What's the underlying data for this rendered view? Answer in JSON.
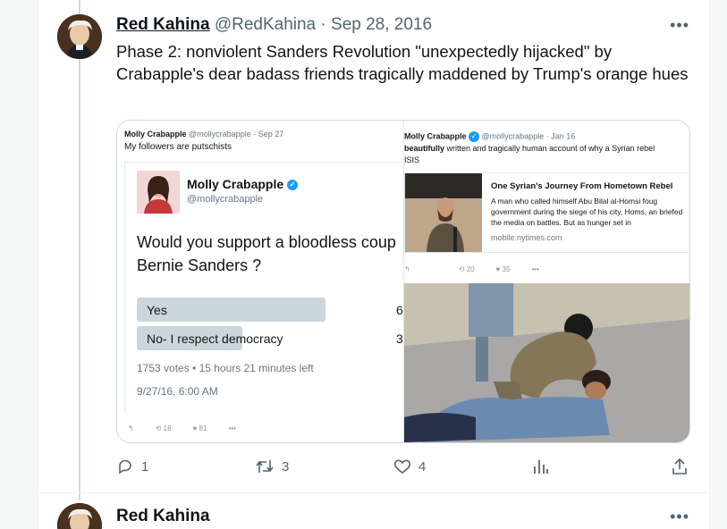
{
  "tweet": {
    "name": "Red Kahina",
    "handle": "@RedKahina",
    "separator": " · ",
    "date": "Sep 28, 2016",
    "more": "•••",
    "text": "Phase 2: nonviolent Sanders Revolution \"unexpectedly hijacked\" by Crabapple's dear badass friends tragically maddened by Trump's orange hues",
    "actions": {
      "reply_count": "1",
      "retweet_count": "3",
      "like_count": "4"
    }
  },
  "left_shot": {
    "header_name": "Molly Crabapple",
    "header_handle": "@mollycrabapple",
    "header_date": "· Sep 27",
    "header_text": "My followers are putschists",
    "name": "Molly Crabapple",
    "handle": "@mollycrabapple",
    "poll_question": "Would you support a bloodless coup",
    "poll_question2": "Bernie Sanders ?",
    "options": [
      {
        "label": "Yes",
        "pct": "6",
        "fill": 0.66
      },
      {
        "label": "No- I respect democracy",
        "pct": "3",
        "fill": 0.37
      }
    ],
    "votes_line": "1753 votes • 15 hours 21 minutes left",
    "timestamp": "9/27/16, 6:00 AM",
    "retweets": "18",
    "likes": "81",
    "more": "•••"
  },
  "right_shot": {
    "name": "Molly Crabapple",
    "handle": "@mollycrabapple",
    "date": "· Jan 16",
    "text_bold": "beautifully",
    "text_rest": " written and tragically human account of why a Syrian rebel",
    "text_line2": "ISIS",
    "card_title": "One Syrian's Journey From Hometown Rebel",
    "card_body": "A man who called himself Abu Bilal al-Homsi foug government during the siege of his city, Homs, an briefed the media on battles. But as hunger set in",
    "card_domain": "mobile.nytimes.com",
    "retweets": "20",
    "likes": "35",
    "more": "•••"
  },
  "next_tweet": {
    "name": "Red Kahina",
    "more": "•••"
  }
}
